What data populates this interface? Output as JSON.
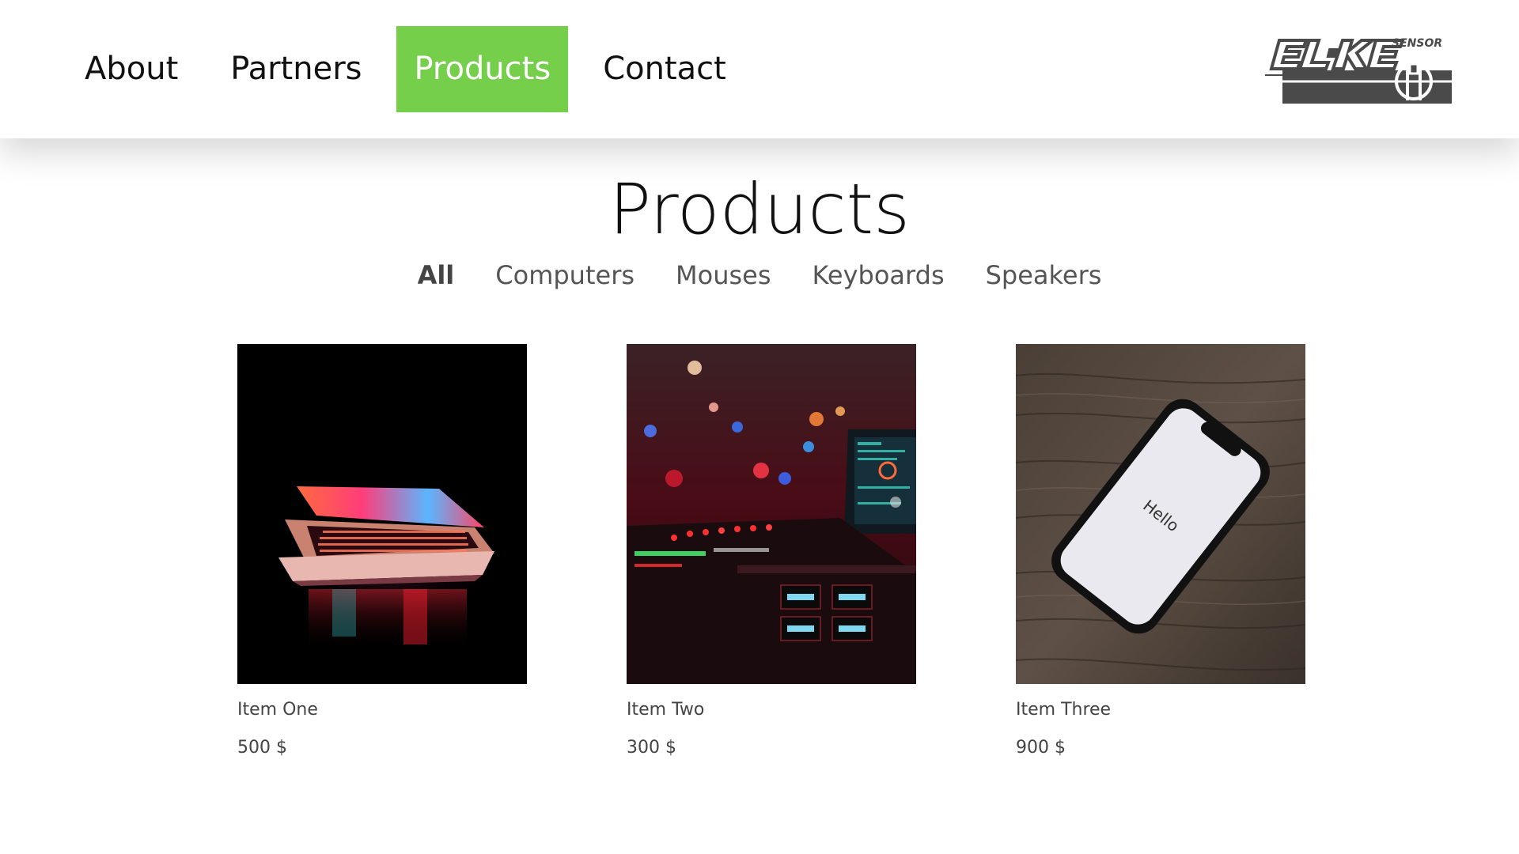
{
  "colors": {
    "accent": "#76cf4b",
    "text": "#111111",
    "muted": "#444444",
    "logo_gray": "#4a4a4a"
  },
  "navbar": {
    "links": [
      {
        "label": "About",
        "active": false
      },
      {
        "label": "Partners",
        "active": false
      },
      {
        "label": "Products",
        "active": true
      },
      {
        "label": "Contact",
        "active": false
      }
    ],
    "logo": {
      "text": "EL-KE",
      "subtext": "SENSOR"
    }
  },
  "main": {
    "title": "Products",
    "filters": [
      {
        "label": "All",
        "active": true
      },
      {
        "label": "Computers",
        "active": false
      },
      {
        "label": "Mouses",
        "active": false
      },
      {
        "label": "Keyboards",
        "active": false
      },
      {
        "label": "Speakers",
        "active": false
      }
    ],
    "products": [
      {
        "name": "Item One",
        "price": "500 $",
        "image": "laptop-photo"
      },
      {
        "name": "Item Two",
        "price": "300 $",
        "image": "dj-equipment-photo"
      },
      {
        "name": "Item Three",
        "price": "900 $",
        "image": "smartphone-photo",
        "screen_text": "Hello"
      }
    ]
  }
}
